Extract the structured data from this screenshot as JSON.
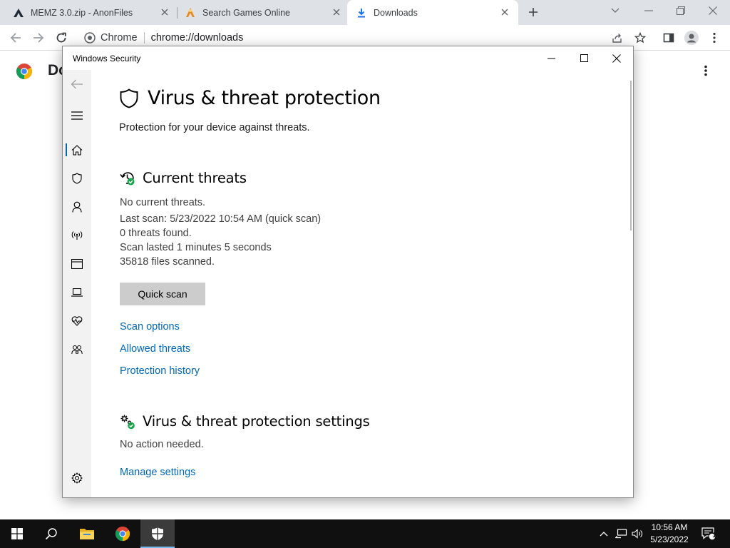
{
  "browser": {
    "tabs": [
      {
        "label": "MEMZ 3.0.zip - AnonFiles",
        "icon": "anonfiles-icon"
      },
      {
        "label": "Search Games Online",
        "icon": "games-site-icon"
      },
      {
        "label": "Downloads",
        "icon": "download-icon",
        "active": true
      }
    ],
    "omnibox": {
      "site_chip": "Chrome",
      "url": "chrome://downloads"
    }
  },
  "downloads_page": {
    "title": "Do"
  },
  "security_window": {
    "title": "Windows Security",
    "page_title": "Virus & threat protection",
    "page_subtitle": "Protection for your device against threats.",
    "current_threats": {
      "heading": "Current threats",
      "lines": [
        "No current threats.",
        "Last scan: 5/23/2022 10:54 AM (quick scan)",
        "0 threats found.",
        "Scan lasted 1 minutes 5 seconds",
        "35818 files scanned."
      ],
      "quick_scan_button": "Quick scan",
      "links": [
        "Scan options",
        "Allowed threats",
        "Protection history"
      ]
    },
    "settings": {
      "heading": "Virus & threat protection settings",
      "status": "No action needed.",
      "link": "Manage settings"
    },
    "sidebar_icons": [
      "back-arrow-icon",
      "hamburger-menu-icon",
      "home-icon",
      "shield-icon",
      "account-icon",
      "firewall-network-icon",
      "app-browser-control-icon",
      "device-security-icon",
      "device-health-icon",
      "family-options-icon",
      "settings-gear-icon"
    ]
  },
  "taskbar": {
    "time": "10:56 AM",
    "date": "5/23/2022",
    "notification_count": "1"
  },
  "colors": {
    "link": "#0067b8",
    "accent_green": "#16a34a",
    "taskbar": "#101010"
  }
}
